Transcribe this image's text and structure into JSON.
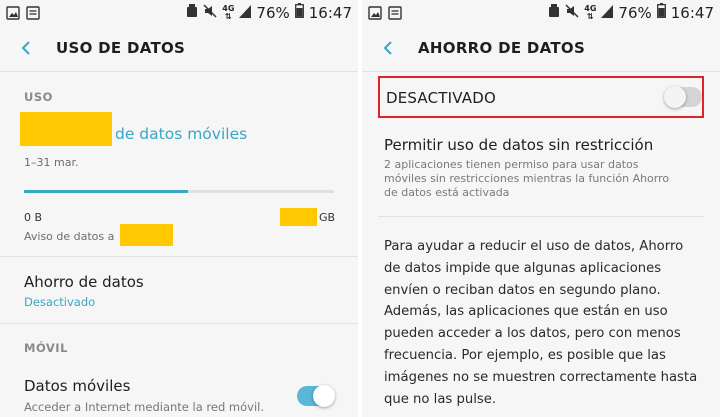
{
  "status_bar": {
    "network": "4G",
    "battery": "76%",
    "time": "16:47"
  },
  "left_screen": {
    "title": "USO DE DATOS",
    "usage_section": "USO",
    "usage_value_suffix": "de datos móviles",
    "billing_period": "1–31 mar.",
    "progress_fraction": 0.53,
    "scale_min": "0 B",
    "scale_max_unit": "GB",
    "warning_prefix": "Aviso de datos a",
    "data_saver": {
      "title": "Ahorro de datos",
      "status": "Desactivado"
    },
    "mobile_section": "MÓVIL",
    "mobile_data": {
      "title": "Datos móviles",
      "subtitle": "Acceder a Internet mediante la red móvil.",
      "enabled": true
    }
  },
  "right_screen": {
    "title": "AHORRO DE DATOS",
    "master_switch": {
      "label": "DESACTIVADO",
      "enabled": false
    },
    "unrestricted": {
      "title": "Permitir uso de datos sin restricción",
      "description": "2 aplicaciones tienen permiso para usar datos móviles sin restricciones mientras la función Ahorro de datos está activada"
    },
    "explanation": "Para ayudar a reducir el uso de datos, Ahorro de datos impide que algunas aplicaciones envíen o reciban datos en segundo plano. Además, las aplicaciones que están en uso pueden acceder a los datos, pero con menos frecuencia. Por ejemplo, es posible que las imágenes no se muestren correctamente hasta que no las pulse."
  },
  "colors": {
    "accent": "#3aa6c4",
    "redaction": "#ffc800",
    "highlight_border": "#e0252a"
  }
}
